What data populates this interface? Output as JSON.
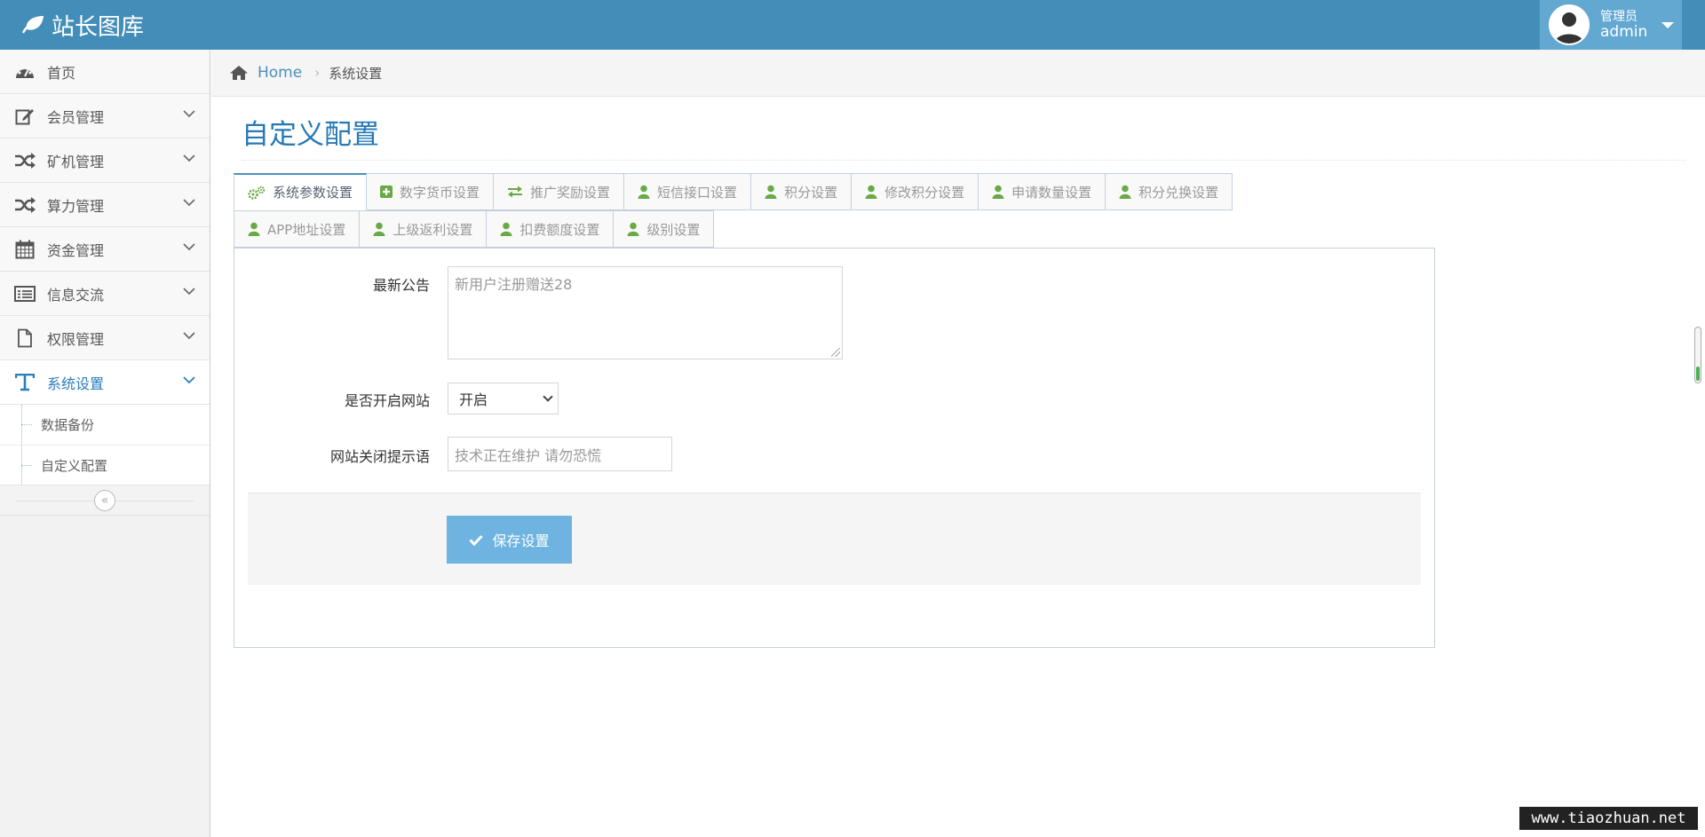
{
  "brand": {
    "title": "站长图库"
  },
  "user": {
    "role": "管理员",
    "name": "admin"
  },
  "sidebar": {
    "items": [
      {
        "label": "首页",
        "icon": "dashboard-icon"
      },
      {
        "label": "会员管理",
        "icon": "edit-icon"
      },
      {
        "label": "矿机管理",
        "icon": "random-icon"
      },
      {
        "label": "算力管理",
        "icon": "random-icon"
      },
      {
        "label": "资金管理",
        "icon": "calendar-icon"
      },
      {
        "label": "信息交流",
        "icon": "list-icon"
      },
      {
        "label": "权限管理",
        "icon": "file-icon"
      },
      {
        "label": "系统设置",
        "icon": "text-icon"
      }
    ],
    "submenu": [
      {
        "label": "数据备份"
      },
      {
        "label": "自定义配置"
      }
    ]
  },
  "breadcrumb": {
    "home": "Home",
    "current": "系统设置"
  },
  "page": {
    "title": "自定义配置"
  },
  "tabs": {
    "row1": [
      {
        "label": "系统参数设置",
        "icon": "gears-icon"
      },
      {
        "label": "数字货币设置",
        "icon": "plus-square-icon"
      },
      {
        "label": "推广奖励设置",
        "icon": "exchange-icon"
      },
      {
        "label": "短信接口设置",
        "icon": "user-icon"
      },
      {
        "label": "积分设置",
        "icon": "user-icon"
      },
      {
        "label": "修改积分设置",
        "icon": "user-icon"
      },
      {
        "label": "申请数量设置",
        "icon": "user-icon"
      },
      {
        "label": "积分兑换设置",
        "icon": "user-icon"
      }
    ],
    "row2": [
      {
        "label": "APP地址设置",
        "icon": "user-icon"
      },
      {
        "label": "上级返利设置",
        "icon": "user-icon"
      },
      {
        "label": "扣费额度设置",
        "icon": "user-icon"
      },
      {
        "label": "级别设置",
        "icon": "user-icon"
      }
    ]
  },
  "form": {
    "notice_label": "最新公告",
    "notice_placeholder": "新用户注册赠送28",
    "site_open_label": "是否开启网站",
    "site_open_value": "开启",
    "close_tip_label": "网站关闭提示语",
    "close_tip_placeholder": "技术正在维护 请勿恐慌",
    "save_label": "保存设置"
  },
  "watermark": "www.tiaozhuan.net",
  "colors": {
    "navbar": "#438eb9",
    "accent": "#2679b5",
    "save_button": "#6fb3e0",
    "tab_icon": "#69aa46"
  }
}
